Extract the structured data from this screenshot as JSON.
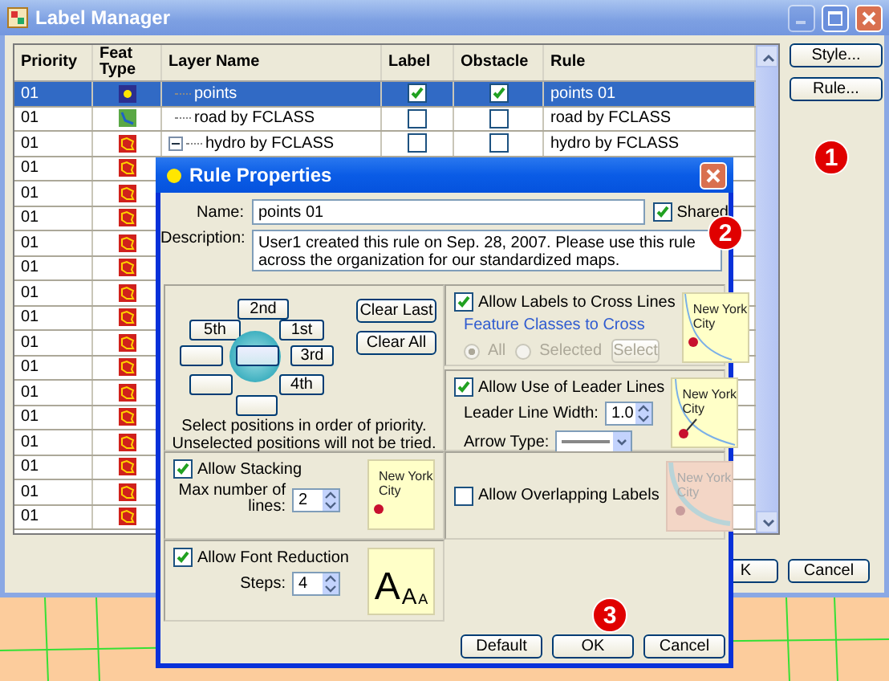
{
  "window": {
    "title": "Label Manager"
  },
  "table": {
    "columns": [
      "Priority",
      "Feat Type",
      "Layer Name",
      "Label",
      "Obstacle",
      "Rule"
    ],
    "rows": [
      {
        "priority": "01",
        "kind": "point",
        "layer_name": "points",
        "label": true,
        "obstacle": true,
        "rule": "points 01",
        "selected": true
      },
      {
        "priority": "01",
        "kind": "line",
        "layer_name": "road by FCLASS",
        "label": false,
        "obstacle": false,
        "rule": "road by FCLASS",
        "selected": false
      },
      {
        "priority": "01",
        "kind": "polygon",
        "layer_name": "hydro by FCLASS",
        "expanded": true,
        "label": false,
        "obstacle": false,
        "rule": "hydro by FCLASS",
        "selected": false
      },
      {
        "priority": "01",
        "kind": "polygon",
        "selected": false
      },
      {
        "priority": "01",
        "kind": "polygon",
        "selected": false
      },
      {
        "priority": "01",
        "kind": "polygon",
        "selected": false
      },
      {
        "priority": "01",
        "kind": "polygon",
        "selected": false
      },
      {
        "priority": "01",
        "kind": "polygon",
        "selected": false
      },
      {
        "priority": "01",
        "kind": "polygon",
        "selected": false
      },
      {
        "priority": "01",
        "kind": "polygon",
        "selected": false
      },
      {
        "priority": "01",
        "kind": "polygon",
        "selected": false
      },
      {
        "priority": "01",
        "kind": "polygon",
        "selected": false
      },
      {
        "priority": "01",
        "kind": "polygon",
        "selected": false
      },
      {
        "priority": "01",
        "kind": "polygon",
        "selected": false
      },
      {
        "priority": "01",
        "kind": "polygon",
        "selected": false
      },
      {
        "priority": "01",
        "kind": "polygon",
        "selected": false
      },
      {
        "priority": "01",
        "kind": "polygon",
        "selected": false
      },
      {
        "priority": "01",
        "kind": "polygon",
        "selected": false
      }
    ]
  },
  "side_buttons": [
    "Style...",
    "Rule..."
  ],
  "bottom_buttons": [
    "K",
    "Cancel"
  ],
  "dialog": {
    "title": "Rule Properties",
    "name_label": "Name:",
    "name_value": "points 01",
    "shared": {
      "label": "Shared",
      "checked": true
    },
    "description_label": "Description:",
    "description": "User1 created this rule on Sep. 28, 2007. Please use this rule across the organization for our standardized maps.",
    "positions": [
      {
        "kind": "ranked",
        "label": "2nd"
      },
      {
        "kind": "ranked",
        "label": "5th"
      },
      {
        "kind": "ranked",
        "label": "1st"
      },
      {
        "kind": "blank"
      },
      {
        "kind": "center"
      },
      {
        "kind": "ranked",
        "label": "3rd"
      },
      {
        "kind": "blank"
      },
      {
        "kind": "ranked",
        "label": "4th"
      },
      {
        "kind": "blank"
      }
    ],
    "clear_buttons": [
      "Clear Last",
      "Clear All"
    ],
    "hint_lines": [
      "Select positions in order of priority.",
      "Unselected positions will not be tried."
    ],
    "cross_lines": {
      "label": "Allow Labels to Cross Lines",
      "checked": true,
      "group_label": "Feature Classes to Cross",
      "disabled": true,
      "options": [
        {
          "label": "All",
          "selected": true
        },
        {
          "label": "Selected",
          "selected": false
        }
      ],
      "select_button": "Select",
      "preview": {
        "kind": "line",
        "text": "New York City"
      }
    },
    "leader_lines": {
      "label": "Allow Use of Leader Lines",
      "checked": true,
      "width_label": "Leader Line Width:",
      "width_value": "1.0",
      "arrow_label": "Arrow Type:",
      "preview": {
        "kind": "leader",
        "text": "New York City"
      }
    },
    "stacking": {
      "label": "Allow Stacking",
      "checked": true,
      "max_label": "Max number of lines:",
      "max_value": "2",
      "preview": {
        "kind": "plain",
        "text": "New York City"
      }
    },
    "overlapping": {
      "label": "Allow Overlapping Labels",
      "checked": false,
      "preview": {
        "kind": "faded",
        "text": "New York City"
      }
    },
    "font_reduction": {
      "label": "Allow Font Reduction",
      "checked": true,
      "steps_label": "Steps:",
      "steps_value": "4",
      "preview_letters": [
        "A",
        "A",
        "A"
      ]
    },
    "buttons": [
      "Default",
      "OK",
      "Cancel"
    ]
  },
  "callouts": [
    "1",
    "2",
    "3"
  ]
}
